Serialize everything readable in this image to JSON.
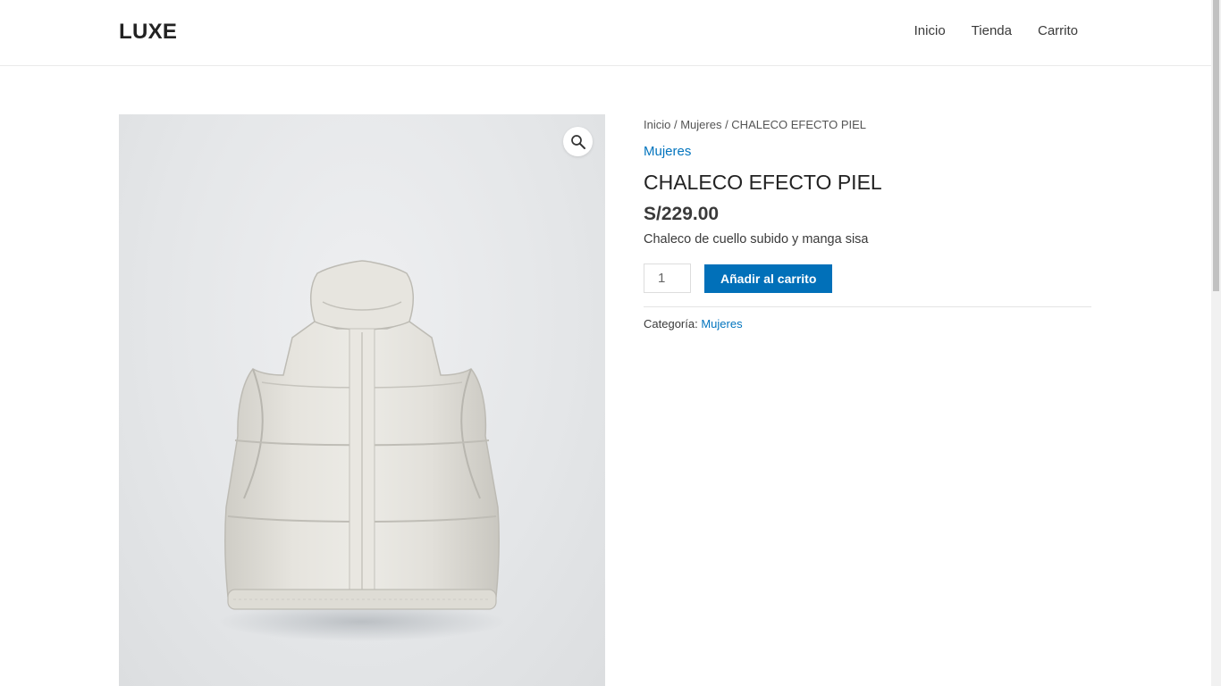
{
  "header": {
    "logo": "LUXE",
    "nav": [
      {
        "label": "Inicio"
      },
      {
        "label": "Tienda"
      },
      {
        "label": "Carrito"
      }
    ]
  },
  "breadcrumb": {
    "home": "Inicio",
    "sep1": " / ",
    "category": "Mujeres",
    "sep2": " / ",
    "current": "CHALECO EFECTO PIEL"
  },
  "product": {
    "category_link": "Mujeres",
    "title": "CHALECO EFECTO PIEL",
    "price": "S/229.00",
    "short_description": "Chaleco de cuello subido y manga sisa",
    "quantity": "1",
    "add_to_cart_label": "Añadir al carrito",
    "meta_label": "Categoría:",
    "meta_category": "Mujeres",
    "zoom_icon": "magnifier-icon"
  },
  "colors": {
    "accent": "#0170b9",
    "link": "#0274be",
    "text": "#3a3a3a"
  }
}
